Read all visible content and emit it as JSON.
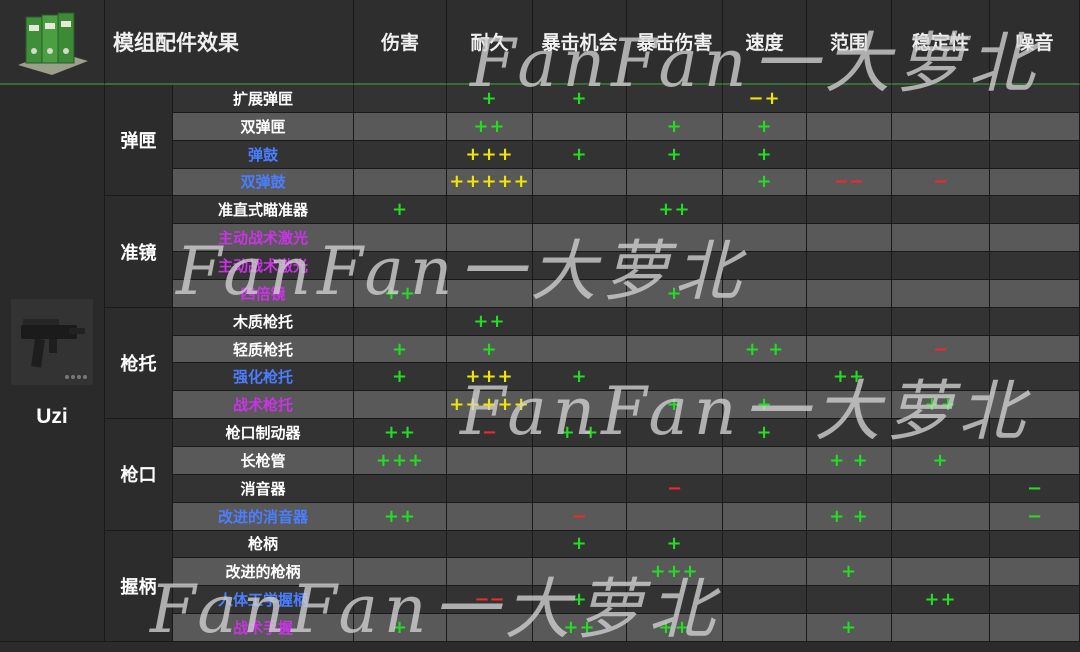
{
  "header": {
    "title": "模组配件效果",
    "columns": [
      "伤害",
      "耐久",
      "暴击机会",
      "暴击伤害",
      "速度",
      "范围",
      "稳定性",
      "噪音"
    ]
  },
  "weapon": {
    "name": "Uzi"
  },
  "groups": [
    {
      "name": "弹匣",
      "rows": [
        {
          "label": "扩展弹匣",
          "color": "white",
          "cells": [
            "",
            "+",
            "+",
            "",
            "−+",
            "",
            "",
            ""
          ],
          "yellow": [
            4
          ]
        },
        {
          "label": "双弹匣",
          "color": "white",
          "cells": [
            "",
            "++",
            "",
            "+",
            "+",
            "",
            "",
            ""
          ]
        },
        {
          "label": "弹鼓",
          "color": "blue",
          "cells": [
            "",
            "+++",
            "+",
            "+",
            "+",
            "",
            "",
            ""
          ],
          "yellow": [
            1
          ]
        },
        {
          "label": "双弹鼓",
          "color": "blue",
          "cells": [
            "",
            "+++++",
            "",
            "",
            "+",
            "−−",
            "−",
            ""
          ],
          "yellow": [
            1
          ]
        }
      ]
    },
    {
      "name": "准镜",
      "rows": [
        {
          "label": "准直式瞄准器",
          "color": "white",
          "cells": [
            "+",
            "",
            "",
            "++",
            "",
            "",
            "",
            ""
          ]
        },
        {
          "label": "主动战术激光",
          "color": "purple",
          "cells": [
            "",
            "",
            "",
            "",
            "",
            "",
            "",
            ""
          ]
        },
        {
          "label": "主动战术激光",
          "color": "purple",
          "cells": [
            "",
            "",
            "",
            "",
            "",
            "",
            "",
            ""
          ]
        },
        {
          "label": "四倍镜",
          "color": "purple",
          "cells": [
            "++",
            "",
            "",
            "+",
            "",
            "",
            "",
            ""
          ]
        }
      ]
    },
    {
      "name": "枪托",
      "rows": [
        {
          "label": "木质枪托",
          "color": "white",
          "cells": [
            "",
            "++",
            "",
            "",
            "",
            "",
            "",
            ""
          ]
        },
        {
          "label": "轻质枪托",
          "color": "white",
          "cells": [
            "+",
            "+",
            "",
            "",
            "+ +",
            "",
            "−",
            ""
          ]
        },
        {
          "label": "强化枪托",
          "color": "blue",
          "cells": [
            "+",
            "+++",
            "+",
            "",
            "",
            "++",
            "",
            ""
          ],
          "yellow": [
            1
          ]
        },
        {
          "label": "战术枪托",
          "color": "purple",
          "cells": [
            "",
            "+++++",
            "",
            "+",
            "+",
            "",
            "++",
            ""
          ],
          "yellow": [
            1
          ]
        }
      ]
    },
    {
      "name": "枪口",
      "rows": [
        {
          "label": "枪口制动器",
          "color": "white",
          "cells": [
            "++",
            "−",
            "+ +",
            "",
            "+",
            "",
            "",
            ""
          ]
        },
        {
          "label": "长枪管",
          "color": "white",
          "cells": [
            "+++",
            "",
            "",
            "",
            "",
            "+ +",
            "+",
            ""
          ]
        },
        {
          "label": "消音器",
          "color": "white",
          "cells": [
            "",
            "",
            "",
            "−",
            "",
            "",
            "",
            "−"
          ],
          "greenneg": [
            7
          ]
        },
        {
          "label": "改进的消音器",
          "color": "blue",
          "cells": [
            "++",
            "",
            "−",
            "",
            "",
            "+ +",
            "",
            "−"
          ],
          "greenneg": [
            7
          ]
        }
      ]
    },
    {
      "name": "握柄",
      "rows": [
        {
          "label": "枪柄",
          "color": "white",
          "cells": [
            "",
            "",
            "+",
            "+",
            "",
            "",
            "",
            ""
          ]
        },
        {
          "label": "改进的枪柄",
          "color": "white",
          "cells": [
            "",
            "",
            "",
            "+++",
            "",
            "+",
            "",
            ""
          ]
        },
        {
          "label": "人体工学握柄",
          "color": "blue",
          "cells": [
            "",
            "−−",
            "+",
            "",
            "",
            "",
            "++",
            ""
          ]
        },
        {
          "label": "战术手握",
          "color": "purple",
          "cells": [
            "+",
            "",
            "++",
            "++",
            "",
            "+",
            "",
            ""
          ]
        }
      ]
    }
  ],
  "watermarks": [
    "FanFan一大萝北",
    "FanFan一大萝北",
    "FanFan一大萝北",
    "FanFan一大萝北"
  ]
}
